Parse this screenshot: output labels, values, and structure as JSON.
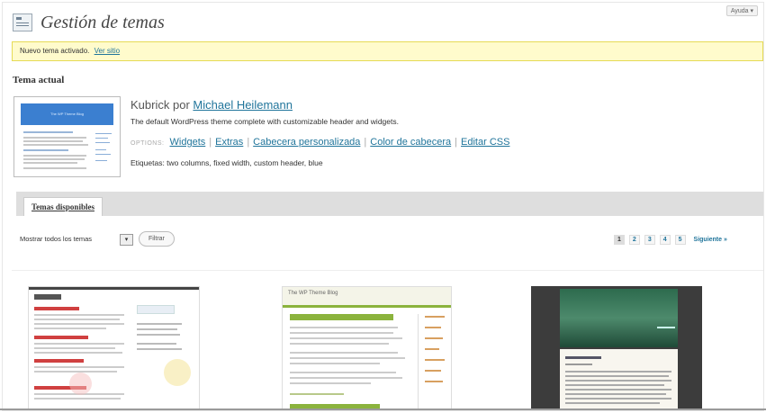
{
  "header": {
    "help_label": "Ayuda ▾",
    "title": "Gestión de temas"
  },
  "notice": {
    "text": "Nuevo tema activado.",
    "link": "Ver sitio"
  },
  "current_theme": {
    "heading": "Tema actual",
    "name": "Kubrick",
    "by": "por",
    "author": "Michael Heilemann",
    "thumbnail_header": "The WP Theme Blog",
    "description": "The default WordPress theme complete with customizable header and widgets.",
    "options_label": "OPTIONS:",
    "options": [
      "Widgets",
      "Extras",
      "Cabecera personalizada",
      "Color de cabecera",
      "Editar CSS"
    ],
    "tags": "Etiquetas: two columns, fixed width, custom header, blue"
  },
  "available": {
    "tab_label": "Temas disponibles",
    "filter_label": "Mostrar todos los temas",
    "filter_select_icon": "▾",
    "filter_button": "Filtrar",
    "pages": [
      "1",
      "2",
      "3",
      "4",
      "5"
    ],
    "next_label": "Siguiente »",
    "thumb2_header": "The WP Theme Blog",
    "colors": {
      "accent": "#21759b",
      "notice_bg": "#fffbcc",
      "notice_border": "#e6db55",
      "tab_bar": "#dedede",
      "green_theme": "#8bb33d"
    }
  }
}
